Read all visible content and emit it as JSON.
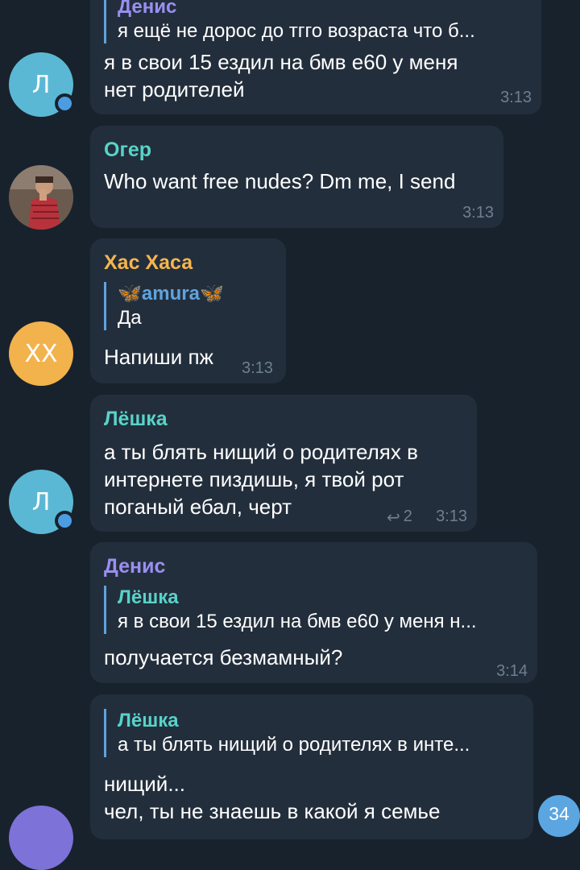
{
  "messages": {
    "m1": {
      "reply_name": "Денис",
      "reply_text": "я ещё не дорос до тгго возраста что б...",
      "text_line1": "я в свои 15 ездил на бмв е60 у меня",
      "text_line2": "нет родителей",
      "time": "3:13",
      "avatar_letter": "Л"
    },
    "m2": {
      "sender": "Oгер",
      "text": "Who want free nudes? Dm me, I send",
      "time": "3:13"
    },
    "m3": {
      "sender": "Хас Хаса",
      "reply_name": "amura",
      "reply_text": "Да",
      "text": "Напиши пж",
      "time": "3:13",
      "avatar_letter": "ХХ"
    },
    "m4": {
      "sender": "Лёшка",
      "text_line1": "а ты блять нищий о родителях в",
      "text_line2": "интернете пиздишь, я твой рот",
      "text_line3": "поганый ебал, черт",
      "replies_count": "2",
      "time": "3:13",
      "avatar_letter": "Л"
    },
    "m5": {
      "sender": "Денис",
      "reply_name": "Лёшка",
      "reply_text": "я в свои 15 ездил на бмв е60 у меня н...",
      "text": "получается безмамный?",
      "time": "3:14"
    },
    "m6": {
      "reply_name": "Лёшка",
      "reply_text": "а ты блять нищий о родителях в инте...",
      "text_line1": "нищий...",
      "text_line2": "чел, ты не знаешь в какой я семье"
    }
  },
  "unread_badge": "34",
  "colors": {
    "background": "#18222d",
    "bubble": "#232e3c",
    "reply_accent": "#5fa3de",
    "avatar_blue": "#5bb8d4",
    "avatar_orange": "#f2b24c",
    "avatar_purple": "#7d72d8",
    "name_oger": "#58d3c9",
    "name_xas": "#f5b54f",
    "name_leshka": "#58d3c9",
    "name_denis": "#9a8ff0",
    "time": "#6d7f8f"
  }
}
